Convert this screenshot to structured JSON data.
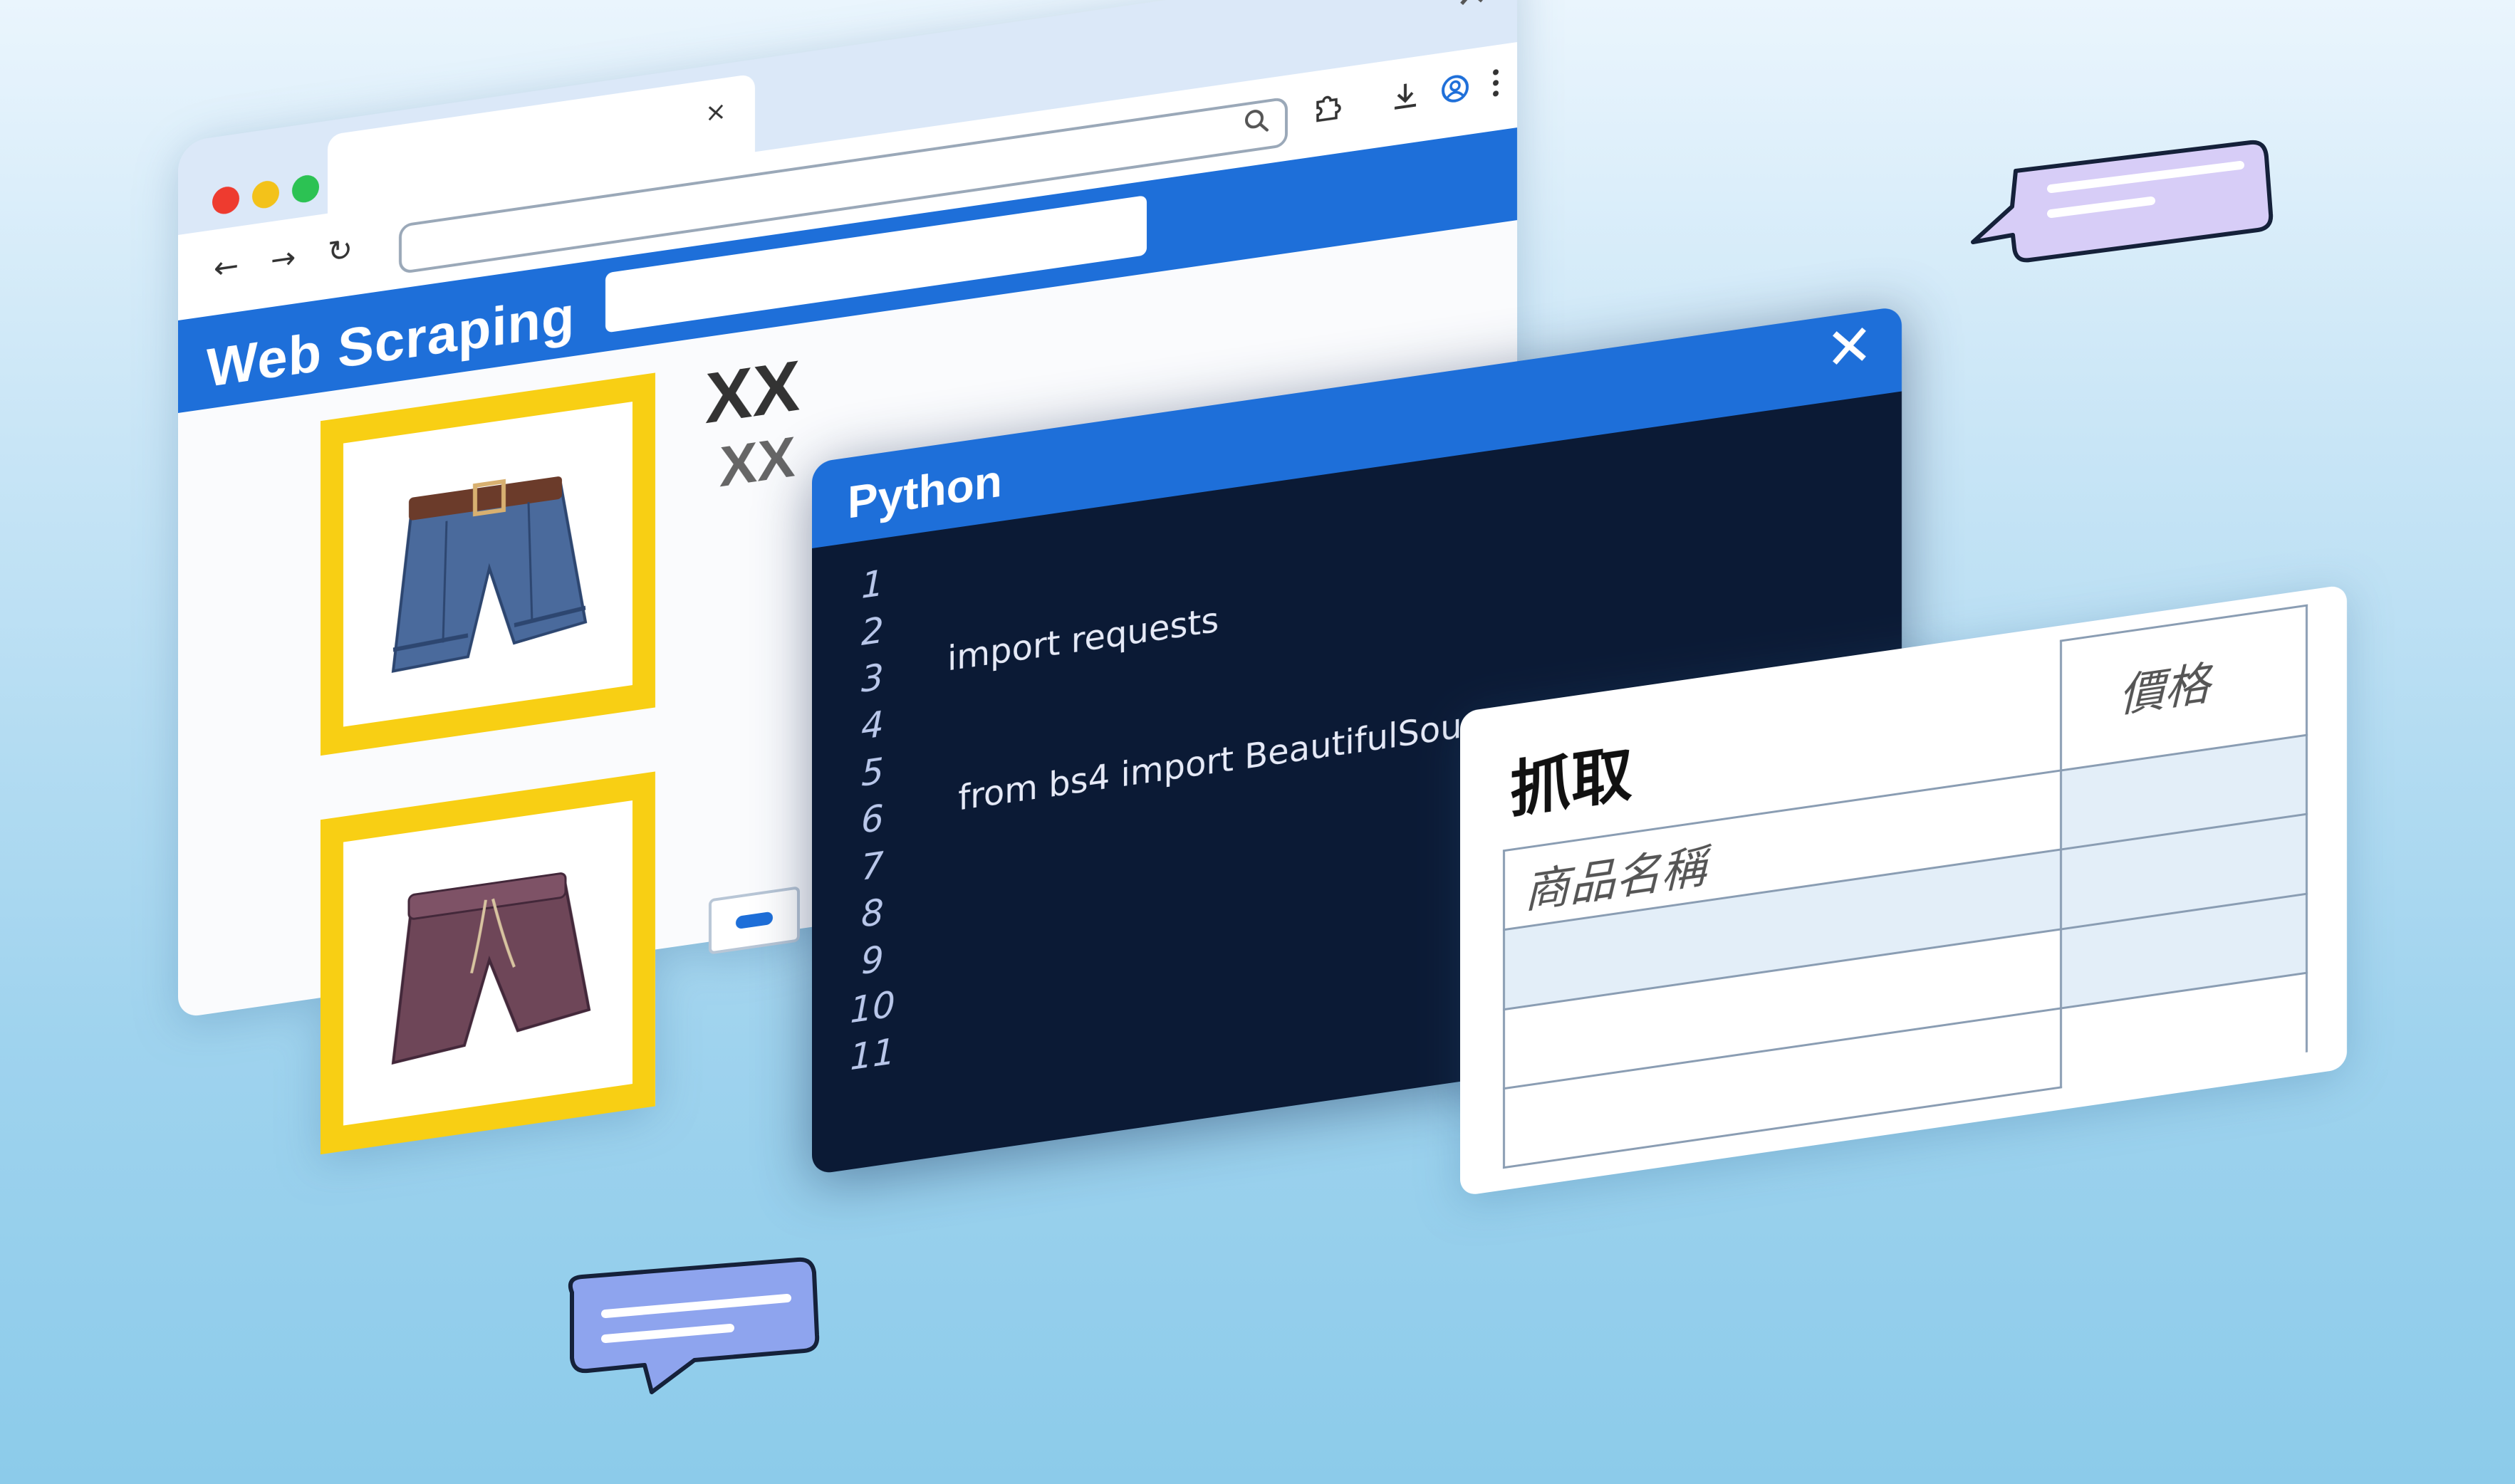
{
  "browser": {
    "tab_close": "×",
    "window_close": "✕",
    "nav": {
      "back": "←",
      "forward": "→",
      "reload": "↻"
    },
    "brand": "Web Scraping",
    "product_title_1": "XX",
    "product_title_2": "XX",
    "colors": {
      "accent": "#1e6fd9",
      "product_frame": "#f8cf14"
    }
  },
  "python": {
    "title": "Python",
    "close": "✕",
    "line_numbers": [
      "1",
      "2",
      "3",
      "4",
      "5",
      "6",
      "7",
      "8",
      "9",
      "10",
      "11"
    ],
    "code": {
      "line1": "import requests",
      "line2": " from bs4 import BeautifulSoup"
    }
  },
  "table": {
    "title": "抓取",
    "header_price": "價格",
    "header_product_name": "商品名稱"
  }
}
